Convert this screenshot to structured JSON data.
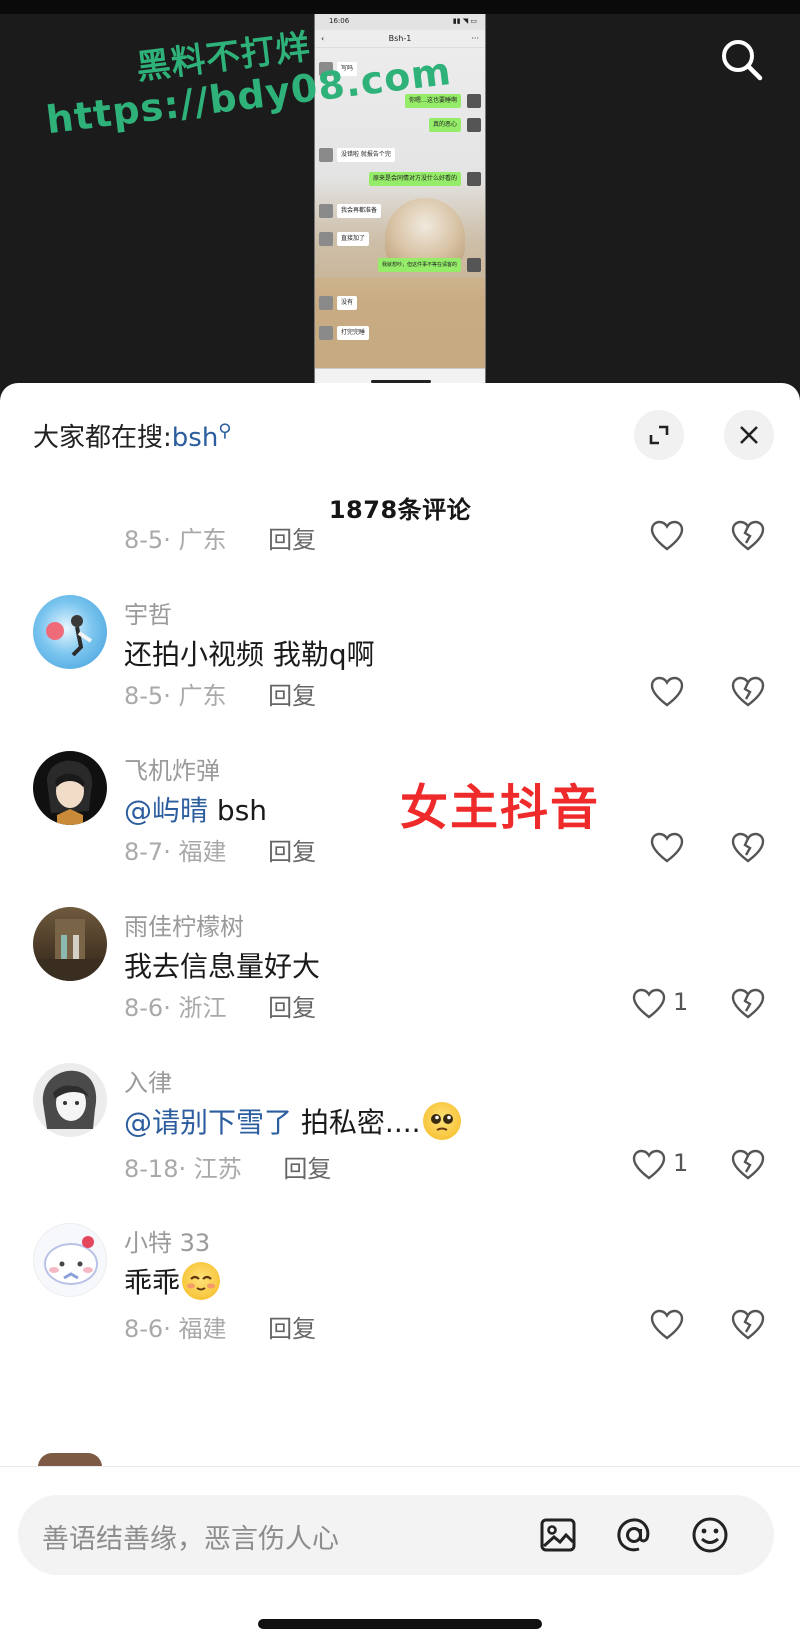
{
  "video": {
    "watermark_line1": "黑料不打烊",
    "watermark_line2": "https://bdy08.com",
    "phone": {
      "status_time": "16:06",
      "title": "Bsh-1",
      "back": "‹",
      "more": "···",
      "messages": [
        "写吗",
        "你嗯…这也要睡啊",
        "真的恶心",
        "没错啦 就报告个完",
        "原来是会同情对方没什么好看的",
        "我会再都准备",
        "直接加了",
        "我就想吵，但这件事不等在请客的",
        "没有",
        "打完完睡"
      ]
    },
    "search_icon": "search-icon"
  },
  "sheet": {
    "hot_search_label": "大家都在搜:",
    "hot_search_keyword": "bsh",
    "comment_count": "1878条评论",
    "overlay_text": "女主抖音",
    "first_meta": {
      "date": "8-5",
      "location": "广东",
      "reply": "回复"
    },
    "comments": [
      {
        "name": "宇哲",
        "text": "还拍小视频 我勒q啊",
        "date": "8-5",
        "location": "广东",
        "reply": "回复",
        "likes": ""
      },
      {
        "name": "飞机炸弹",
        "mention": "@屿晴",
        "text": " bsh",
        "date": "8-7",
        "location": "福建",
        "reply": "回复",
        "likes": ""
      },
      {
        "name": "雨佳柠檬树",
        "text": "我去信息量好大",
        "date": "8-6",
        "location": "浙江",
        "reply": "回复",
        "likes": "1"
      },
      {
        "name": "入律",
        "mention": "@请别下雪了",
        "text": " 拍私密....",
        "date": "8-18",
        "location": "江苏",
        "reply": "回复",
        "likes": "1"
      },
      {
        "name": "小特 33",
        "text": "乖乖",
        "date": "8-6",
        "location": "福建",
        "reply": "回复",
        "likes": ""
      }
    ],
    "input_placeholder": "善语结善缘，恶言伤人心",
    "icons": [
      "expand-icon",
      "close-icon",
      "heart-icon",
      "broken-heart-icon",
      "image-icon",
      "at-icon",
      "emoji-icon"
    ]
  }
}
